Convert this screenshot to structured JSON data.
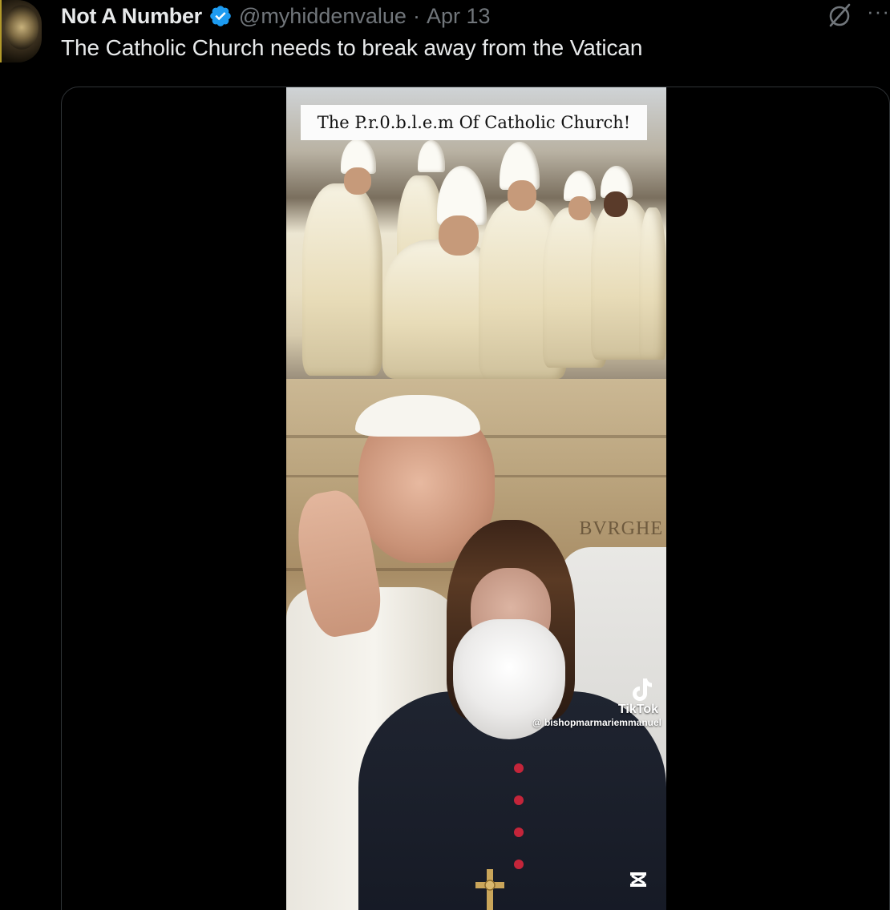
{
  "post": {
    "display_name": "Not A Number",
    "handle": "@myhiddenvalue",
    "separator": "·",
    "date": "Apr 13",
    "text": "The Catholic Church needs to break away from the Vatican",
    "more_label": "···"
  },
  "media": {
    "caption": "The P.r.0.b.l.e.m Of Catholic Church!",
    "facade_inscription": "BVRGHE",
    "watermark": {
      "brand": "TikTok",
      "username": "@ bishopmarmariemmanuel"
    }
  },
  "icons": {
    "verified": "verified-badge-icon",
    "grok": "grok-icon",
    "more": "more-icon",
    "tiktok": "tiktok-icon",
    "capcut": "capcut-icon"
  },
  "colors": {
    "background": "#000000",
    "text_primary": "#e7e9ea",
    "text_secondary": "#71767b",
    "verified_blue": "#1d9bf0",
    "card_border": "#2f3336"
  }
}
